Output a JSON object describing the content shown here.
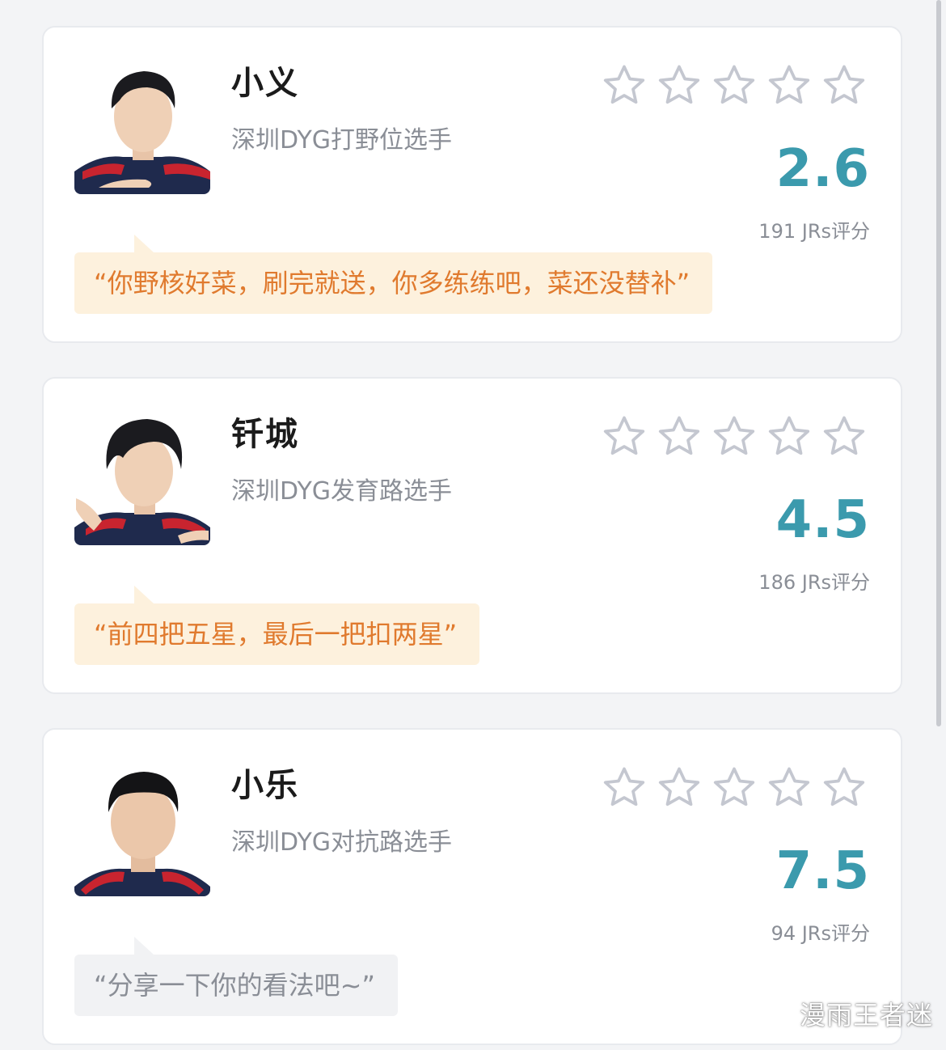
{
  "players": [
    {
      "name": "小义",
      "role": "深圳DYG打野位选手",
      "score": "2.6",
      "raters": "191 JRs评分",
      "comment": "“你野核好菜，刷完就送，你多练练吧，菜还没替补”",
      "comment_style": "quote",
      "stars_filled": 0,
      "stars_total": 5
    },
    {
      "name": "钎城",
      "role": "深圳DYG发育路选手",
      "score": "4.5",
      "raters": "186 JRs评分",
      "comment": "“前四把五星，最后一把扣两星”",
      "comment_style": "quote",
      "stars_filled": 0,
      "stars_total": 5
    },
    {
      "name": "小乐",
      "role": "深圳DYG对抗路选手",
      "score": "7.5",
      "raters": "94 JRs评分",
      "comment": "“分享一下你的看法吧~”",
      "comment_style": "prompt",
      "stars_filled": 0,
      "stars_total": 5
    }
  ],
  "watermark": "漫雨王者迷",
  "colors": {
    "score": "#3b9aad",
    "star_outline": "#c4c7d0",
    "quote_text": "#e07a2e",
    "quote_bg": "#fdf1dd",
    "prompt_bg": "#f1f2f4"
  }
}
